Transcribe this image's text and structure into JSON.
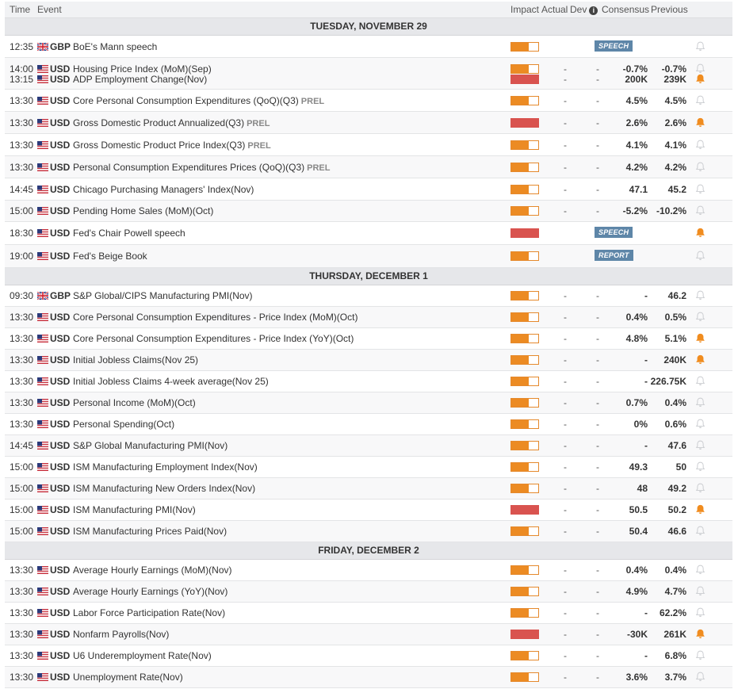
{
  "header": {
    "time": "Time",
    "event": "Event",
    "impact": "Impact",
    "actual": "Actual",
    "dev": "Dev",
    "consensus": "Consensus",
    "previous": "Previous",
    "info_glyph": "i"
  },
  "colors": {
    "impact_medium": "#ec8b23",
    "impact_high": "#d9534f",
    "badge": "#5e86a8",
    "bell_active": "#f08c1f",
    "bell_inactive": "#c9cbcf"
  },
  "days": [
    {
      "label": "TUESDAY, NOVEMBER 29",
      "rows": [
        {
          "h": 28,
          "events": [
            {
              "time": "12:35",
              "currency": "GBP",
              "flag": "uk",
              "name": "BoE's Mann speech",
              "impact": "medium",
              "badge": "SPEECH",
              "bell": false
            }
          ]
        },
        {
          "h": 40,
          "events": [
            {
              "time": "14:00",
              "currency": "USD",
              "flag": "us",
              "name": "Housing Price Index (MoM)(Sep)",
              "impact": "medium",
              "actual": "-",
              "dev": "-",
              "consensus": "-0.7%",
              "previous": "-0.7%",
              "bell": false
            },
            {
              "time": "13:15",
              "currency": "USD",
              "flag": "us",
              "name": "ADP Employment Change(Nov)",
              "impact": "high",
              "actual": "-",
              "dev": "-",
              "consensus": "200K",
              "previous": "239K",
              "bell": true
            }
          ]
        },
        {
          "h": 28,
          "events": [
            {
              "time": "13:30",
              "currency": "USD",
              "flag": "us",
              "name": "Core Personal Consumption Expenditures (QoQ)(Q3)",
              "tag": "PREL",
              "impact": "medium",
              "actual": "-",
              "dev": "-",
              "consensus": "4.5%",
              "previous": "4.5%",
              "bell": false
            }
          ]
        },
        {
          "h": 28,
          "events": [
            {
              "time": "13:30",
              "currency": "USD",
              "flag": "us",
              "name": "Gross Domestic Product Annualized(Q3)",
              "tag": "PREL",
              "impact": "high",
              "actual": "-",
              "dev": "-",
              "consensus": "2.6%",
              "previous": "2.6%",
              "bell": true
            }
          ]
        },
        {
          "h": 28,
          "events": [
            {
              "time": "13:30",
              "currency": "USD",
              "flag": "us",
              "name": "Gross Domestic Product Price Index(Q3)",
              "tag": "PREL",
              "impact": "medium",
              "actual": "-",
              "dev": "-",
              "consensus": "4.1%",
              "previous": "4.1%",
              "bell": false
            }
          ]
        },
        {
          "h": 28,
          "events": [
            {
              "time": "13:30",
              "currency": "USD",
              "flag": "us",
              "name": "Personal Consumption Expenditures Prices (QoQ)(Q3)",
              "tag": "PREL",
              "impact": "medium",
              "actual": "-",
              "dev": "-",
              "consensus": "4.2%",
              "previous": "4.2%",
              "bell": false
            }
          ]
        },
        {
          "h": 28,
          "events": [
            {
              "time": "14:45",
              "currency": "USD",
              "flag": "us",
              "name": "Chicago Purchasing Managers' Index(Nov)",
              "impact": "medium",
              "actual": "-",
              "dev": "-",
              "consensus": "47.1",
              "previous": "45.2",
              "bell": false
            }
          ]
        },
        {
          "h": 27,
          "events": [
            {
              "time": "15:00",
              "currency": "USD",
              "flag": "us",
              "name": "Pending Home Sales (MoM)(Oct)",
              "impact": "medium",
              "actual": "-",
              "dev": "-",
              "consensus": "-5.2%",
              "previous": "-10.2%",
              "bell": false
            }
          ]
        },
        {
          "h": 29,
          "events": [
            {
              "time": "18:30",
              "currency": "USD",
              "flag": "us",
              "name": "Fed's Chair Powell speech",
              "impact": "high",
              "badge": "SPEECH",
              "bell": true
            }
          ]
        },
        {
          "h": 29,
          "events": [
            {
              "time": "19:00",
              "currency": "USD",
              "flag": "us",
              "name": "Fed's Beige Book",
              "impact": "medium",
              "badge": "REPORT",
              "bell": false
            }
          ]
        }
      ]
    },
    {
      "label": "THURSDAY, DECEMBER 1",
      "rows": [
        {
          "h": 27,
          "events": [
            {
              "time": "09:30",
              "currency": "GBP",
              "flag": "uk",
              "name": "S&P Global/CIPS Manufacturing PMI(Nov)",
              "impact": "medium",
              "actual": "-",
              "dev": "-",
              "consensus": "-",
              "previous": "46.2",
              "bell": false
            }
          ]
        },
        {
          "h": 27,
          "events": [
            {
              "time": "13:30",
              "currency": "USD",
              "flag": "us",
              "name": "Core Personal Consumption Expenditures - Price Index (MoM)(Oct)",
              "impact": "medium",
              "actual": "-",
              "dev": "-",
              "consensus": "0.4%",
              "previous": "0.5%",
              "bell": false
            }
          ]
        },
        {
          "h": 27,
          "events": [
            {
              "time": "13:30",
              "currency": "USD",
              "flag": "us",
              "name": "Core Personal Consumption Expenditures - Price Index (YoY)(Oct)",
              "impact": "medium",
              "actual": "-",
              "dev": "-",
              "consensus": "4.8%",
              "previous": "5.1%",
              "bell": true
            }
          ]
        },
        {
          "h": 27,
          "events": [
            {
              "time": "13:30",
              "currency": "USD",
              "flag": "us",
              "name": "Initial Jobless Claims(Nov 25)",
              "impact": "medium",
              "actual": "-",
              "dev": "-",
              "consensus": "-",
              "previous": "240K",
              "bell": true
            }
          ]
        },
        {
          "h": 27,
          "events": [
            {
              "time": "13:30",
              "currency": "USD",
              "flag": "us",
              "name": "Initial Jobless Claims 4-week average(Nov 25)",
              "impact": "medium",
              "actual": "-",
              "dev": "-",
              "consensus": "-",
              "previous": "226.75K",
              "bell": false
            }
          ]
        },
        {
          "h": 27,
          "events": [
            {
              "time": "13:30",
              "currency": "USD",
              "flag": "us",
              "name": "Personal Income (MoM)(Oct)",
              "impact": "medium",
              "actual": "-",
              "dev": "-",
              "consensus": "0.7%",
              "previous": "0.4%",
              "bell": false
            }
          ]
        },
        {
          "h": 27,
          "events": [
            {
              "time": "13:30",
              "currency": "USD",
              "flag": "us",
              "name": "Personal Spending(Oct)",
              "impact": "medium",
              "actual": "-",
              "dev": "-",
              "consensus": "0%",
              "previous": "0.6%",
              "bell": false
            }
          ]
        },
        {
          "h": 27,
          "events": [
            {
              "time": "14:45",
              "currency": "USD",
              "flag": "us",
              "name": "S&P Global Manufacturing PMI(Nov)",
              "impact": "medium",
              "actual": "-",
              "dev": "-",
              "consensus": "-",
              "previous": "47.6",
              "bell": false
            }
          ]
        },
        {
          "h": 27,
          "events": [
            {
              "time": "15:00",
              "currency": "USD",
              "flag": "us",
              "name": "ISM Manufacturing Employment Index(Nov)",
              "impact": "medium",
              "actual": "-",
              "dev": "-",
              "consensus": "49.3",
              "previous": "50",
              "bell": false
            }
          ]
        },
        {
          "h": 27,
          "events": [
            {
              "time": "15:00",
              "currency": "USD",
              "flag": "us",
              "name": "ISM Manufacturing New Orders Index(Nov)",
              "impact": "medium",
              "actual": "-",
              "dev": "-",
              "consensus": "48",
              "previous": "49.2",
              "bell": false
            }
          ]
        },
        {
          "h": 27,
          "events": [
            {
              "time": "15:00",
              "currency": "USD",
              "flag": "us",
              "name": "ISM Manufacturing PMI(Nov)",
              "impact": "high",
              "actual": "-",
              "dev": "-",
              "consensus": "50.5",
              "previous": "50.2",
              "bell": true
            }
          ]
        },
        {
          "h": 27,
          "events": [
            {
              "time": "15:00",
              "currency": "USD",
              "flag": "us",
              "name": "ISM Manufacturing Prices Paid(Nov)",
              "impact": "medium",
              "actual": "-",
              "dev": "-",
              "consensus": "50.4",
              "previous": "46.6",
              "bell": false
            }
          ]
        }
      ]
    },
    {
      "label": "FRIDAY, DECEMBER 2",
      "rows": [
        {
          "h": 27,
          "events": [
            {
              "time": "13:30",
              "currency": "USD",
              "flag": "us",
              "name": "Average Hourly Earnings (MoM)(Nov)",
              "impact": "medium",
              "actual": "-",
              "dev": "-",
              "consensus": "0.4%",
              "previous": "0.4%",
              "bell": false
            }
          ]
        },
        {
          "h": 27,
          "events": [
            {
              "time": "13:30",
              "currency": "USD",
              "flag": "us",
              "name": "Average Hourly Earnings (YoY)(Nov)",
              "impact": "medium",
              "actual": "-",
              "dev": "-",
              "consensus": "4.9%",
              "previous": "4.7%",
              "bell": false
            }
          ]
        },
        {
          "h": 27,
          "events": [
            {
              "time": "13:30",
              "currency": "USD",
              "flag": "us",
              "name": "Labor Force Participation Rate(Nov)",
              "impact": "medium",
              "actual": "-",
              "dev": "-",
              "consensus": "-",
              "previous": "62.2%",
              "bell": false
            }
          ]
        },
        {
          "h": 27,
          "events": [
            {
              "time": "13:30",
              "currency": "USD",
              "flag": "us",
              "name": "Nonfarm Payrolls(Nov)",
              "impact": "high",
              "actual": "-",
              "dev": "-",
              "consensus": "-30K",
              "previous": "261K",
              "bell": true
            }
          ]
        },
        {
          "h": 27,
          "events": [
            {
              "time": "13:30",
              "currency": "USD",
              "flag": "us",
              "name": "U6 Underemployment Rate(Nov)",
              "impact": "medium",
              "actual": "-",
              "dev": "-",
              "consensus": "-",
              "previous": "6.8%",
              "bell": false
            }
          ]
        },
        {
          "h": 27,
          "events": [
            {
              "time": "13:30",
              "currency": "USD",
              "flag": "us",
              "name": "Unemployment Rate(Nov)",
              "impact": "medium",
              "actual": "-",
              "dev": "-",
              "consensus": "3.6%",
              "previous": "3.7%",
              "bell": false
            }
          ]
        }
      ]
    }
  ]
}
